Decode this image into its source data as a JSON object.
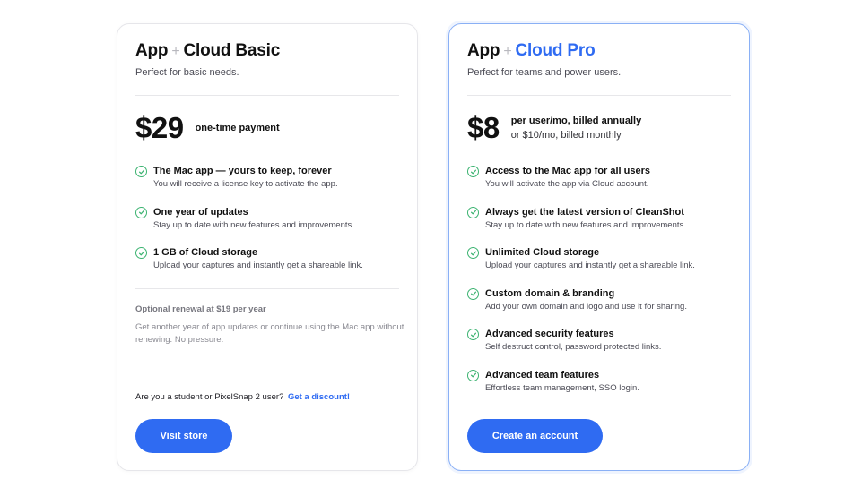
{
  "colors": {
    "accent": "#2f6bf2",
    "check": "#3cb371",
    "pro_border": "#8ab0f5"
  },
  "basic": {
    "title_app": "App",
    "title_plus": "+",
    "title_plan": "Cloud Basic",
    "subtitle": "Perfect for basic needs.",
    "price": "$29",
    "price_note": "one-time payment",
    "features": [
      {
        "icon": "check-circle-icon",
        "title": "The Mac app — yours to keep, forever",
        "desc": "You will receive a license key to activate the app."
      },
      {
        "icon": "check-circle-icon",
        "title": "One year of updates",
        "desc": "Stay up to date with new features and improvements."
      },
      {
        "icon": "check-circle-icon",
        "title": "1 GB of Cloud storage",
        "desc": "Upload your captures and instantly get a shareable link."
      }
    ],
    "renewal_title": "Optional renewal at $19 per year",
    "renewal_desc": "Get another year of app updates or continue using the Mac app without renewing. No pressure.",
    "discount_text": "Are you a student or PixelSnap 2 user?",
    "discount_link": "Get a discount!",
    "button": "Visit store"
  },
  "pro": {
    "title_app": "App",
    "title_plus": "+",
    "title_plan": "Cloud Pro",
    "subtitle": "Perfect for teams and power users.",
    "price": "$8",
    "price_note_line1": "per user/mo, billed annually",
    "price_note_line2": "or $10/mo, billed monthly",
    "features": [
      {
        "icon": "check-circle-icon",
        "title": "Access to the Mac app for all users",
        "desc": "You will activate the app via Cloud account."
      },
      {
        "icon": "check-circle-icon",
        "title": "Always get the latest version of CleanShot",
        "desc": "Stay up to date with new features and improvements."
      },
      {
        "icon": "check-circle-icon",
        "title": "Unlimited Cloud storage",
        "desc": "Upload your captures and instantly get a shareable link."
      },
      {
        "icon": "check-circle-icon",
        "title": "Custom domain & branding",
        "desc": "Add your own domain and logo and use it for sharing."
      },
      {
        "icon": "check-circle-icon",
        "title": "Advanced security features",
        "desc": "Self destruct control, password protected links."
      },
      {
        "icon": "check-circle-icon",
        "title": "Advanced team features",
        "desc": "Effortless team management, SSO login."
      }
    ],
    "button": "Create an account"
  }
}
